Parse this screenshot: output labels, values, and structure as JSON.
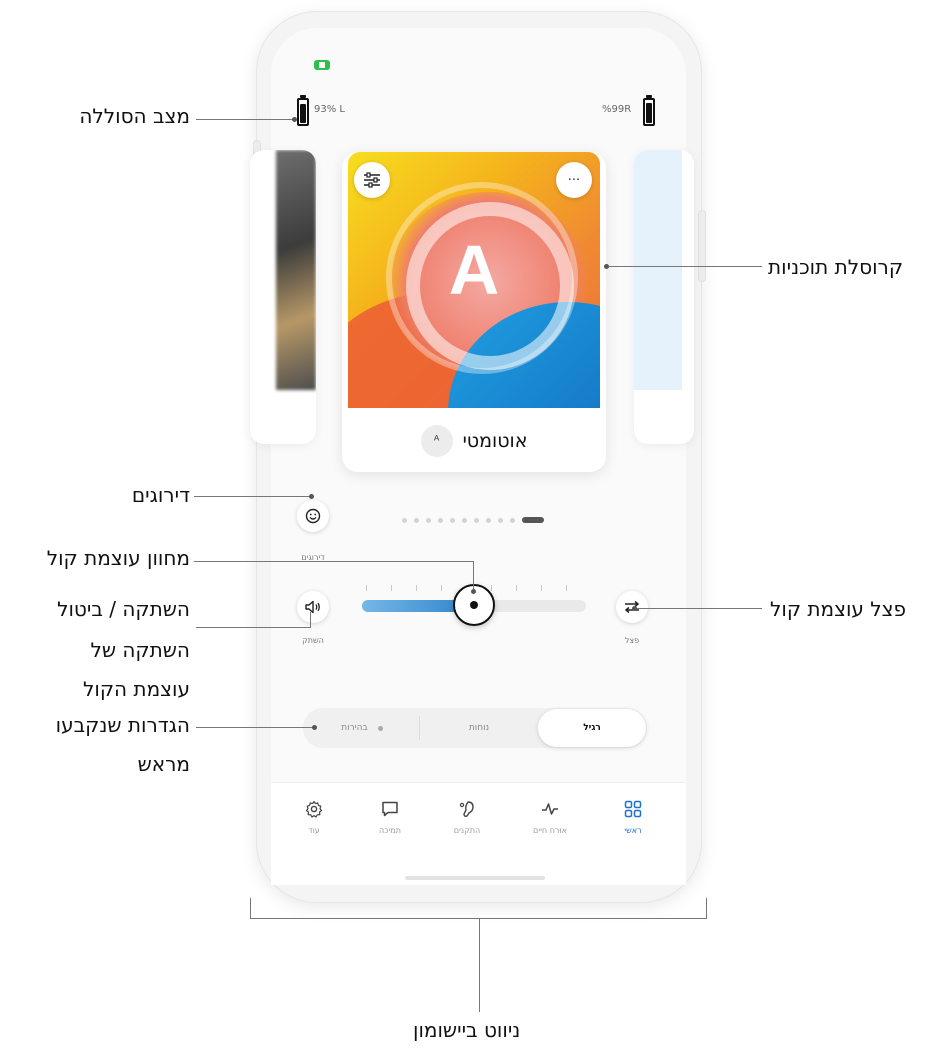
{
  "status": {
    "battery_left": "93% L",
    "battery_right": "%99R"
  },
  "program": {
    "letter": "A",
    "name": "אוטומטי",
    "icon": "hearing-aid-auto-icon",
    "more_icon": "ellipsis-icon",
    "settings_icon": "sliders-icon"
  },
  "carousel": {
    "page_count": 8,
    "active_index": 7
  },
  "ratings": {
    "label": "דירוגים",
    "icon": "smile-icon"
  },
  "mute": {
    "label": "השתק",
    "icon": "speaker-icon"
  },
  "split": {
    "label": "פצל",
    "icon": "split-arrows-icon"
  },
  "volume": {
    "level": 0.5
  },
  "presets": {
    "items": [
      "רגיל",
      "נוחות",
      "בהירות"
    ],
    "selected": "רגיל"
  },
  "nav": {
    "items": [
      {
        "label": "ראשי",
        "icon": "grid-icon",
        "active": true
      },
      {
        "label": "אורח חיים",
        "icon": "activity-icon",
        "active": false
      },
      {
        "label": "התקנים",
        "icon": "hearing-aid-icon",
        "active": false
      },
      {
        "label": "תמיכה",
        "icon": "chat-icon",
        "active": false
      },
      {
        "label": "עוד",
        "icon": "gear-icon",
        "active": false
      }
    ]
  },
  "callouts": {
    "battery_status": "מצב הסוללה",
    "program_carousel": "קרוסלת תוכניות",
    "ratings": "דירוגים",
    "volume_indicator": "מחוון עוצמת קול",
    "volume_split": "פצל עוצמת קול",
    "mute_line1": "השתקה / ביטול",
    "mute_line2": "השתקה של",
    "mute_line3": "עוצמת הקול",
    "presets_line1": "הגדרות שנקבעו",
    "presets_line2": "מראש",
    "app_navigation": "ניווט ביישומון"
  }
}
